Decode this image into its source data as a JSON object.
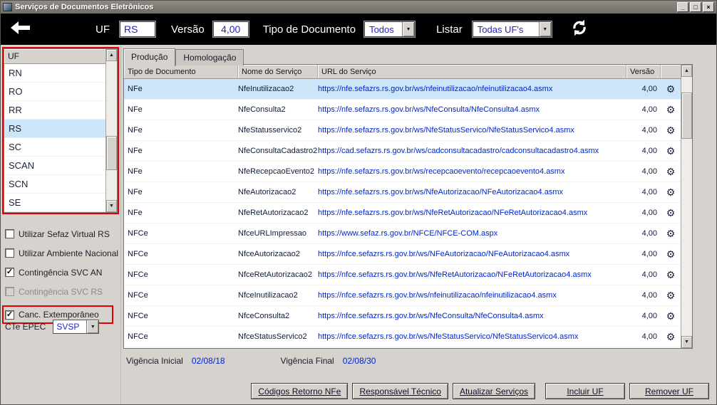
{
  "window": {
    "title": "Serviços de Documentos Eletrônicos",
    "controls": {
      "minimize": "_",
      "maximize": "□",
      "close": "×"
    }
  },
  "toolbar": {
    "uf_label": "UF",
    "uf_value": "RS",
    "versao_label": "Versão",
    "versao_value": "4,00",
    "tipo_documento_label": "Tipo de Documento",
    "tipo_documento_value": "Todos",
    "listar_label": "Listar",
    "listar_value": "Todas UF's"
  },
  "sidebar": {
    "list_header": "UF",
    "uf_items": [
      {
        "label": "RN",
        "selected": false
      },
      {
        "label": "RO",
        "selected": false
      },
      {
        "label": "RR",
        "selected": false
      },
      {
        "label": "RS",
        "selected": true
      },
      {
        "label": "SC",
        "selected": false
      },
      {
        "label": "SCAN",
        "selected": false
      },
      {
        "label": "SCN",
        "selected": false
      },
      {
        "label": "SE",
        "selected": false
      }
    ],
    "checkboxes": [
      {
        "label": "Utilizar Sefaz Virtual RS",
        "checked": false,
        "disabled": false,
        "highlighted": false
      },
      {
        "label": "Utilizar Ambiente Nacional",
        "checked": false,
        "disabled": false,
        "highlighted": false
      },
      {
        "label": "Contingência SVC AN",
        "checked": true,
        "disabled": false,
        "highlighted": false
      },
      {
        "label": "Contingência SVC RS",
        "checked": false,
        "disabled": true,
        "highlighted": false
      },
      {
        "label": "Canc. Extemporâneo",
        "checked": true,
        "disabled": false,
        "highlighted": true
      }
    ],
    "cte_epec_label": "CTe EPEC",
    "cte_epec_value": "SVSP"
  },
  "tabs": [
    {
      "label": "Produção",
      "active": true
    },
    {
      "label": "Homologação",
      "active": false
    }
  ],
  "table": {
    "columns": [
      "Tipo de Documento",
      "Nome do Serviço",
      "URL do Serviço",
      "Versão"
    ],
    "rows": [
      {
        "tipo": "NFe",
        "nome": "NfeInutilizacao2",
        "url": "https://nfe.sefazrs.rs.gov.br/ws/nfeinutilizacao/nfeinutilizacao4.asmx",
        "versao": "4,00",
        "selected": true
      },
      {
        "tipo": "NFe",
        "nome": "NfeConsulta2",
        "url": "https://nfe.sefazrs.rs.gov.br/ws/NfeConsulta/NfeConsulta4.asmx",
        "versao": "4,00",
        "selected": false
      },
      {
        "tipo": "NFe",
        "nome": "NfeStatusservico2",
        "url": "https://nfe.sefazrs.rs.gov.br/ws/NfeStatusServico/NfeStatusServico4.asmx",
        "versao": "4,00",
        "selected": false
      },
      {
        "tipo": "NFe",
        "nome": "NfeConsultaCadastro2",
        "url": "https://cad.sefazrs.rs.gov.br/ws/cadconsultacadastro/cadconsultacadastro4.asmx",
        "versao": "4,00",
        "selected": false
      },
      {
        "tipo": "NFe",
        "nome": "NfeRecepcaoEvento2",
        "url": "https://nfe.sefazrs.rs.gov.br/ws/recepcaoevento/recepcaoevento4.asmx",
        "versao": "4,00",
        "selected": false
      },
      {
        "tipo": "NFe",
        "nome": "NfeAutorizacao2",
        "url": "https://nfe.sefazrs.rs.gov.br/ws/NfeAutorizacao/NFeAutorizacao4.asmx",
        "versao": "4,00",
        "selected": false
      },
      {
        "tipo": "NFe",
        "nome": "NfeRetAutorizacao2",
        "url": "https://nfe.sefazrs.rs.gov.br/ws/NfeRetAutorizacao/NFeRetAutorizacao4.asmx",
        "versao": "4,00",
        "selected": false
      },
      {
        "tipo": "NFCe",
        "nome": "NfceURLImpressao",
        "url": "https://www.sefaz.rs.gov.br/NFCE/NFCE-COM.aspx",
        "versao": "4,00",
        "selected": false
      },
      {
        "tipo": "NFCe",
        "nome": "NfceAutorizacao2",
        "url": "https://nfce.sefazrs.rs.gov.br/ws/NFeAutorizacao/NFeAutorizacao4.asmx",
        "versao": "4,00",
        "selected": false
      },
      {
        "tipo": "NFCe",
        "nome": "NfceRetAutorizacao2",
        "url": "https://nfce.sefazrs.rs.gov.br/ws/NfeRetAutorizacao/NFeRetAutorizacao4.asmx",
        "versao": "4,00",
        "selected": false
      },
      {
        "tipo": "NFCe",
        "nome": "NfceInutilizacao2",
        "url": "https://nfce.sefazrs.rs.gov.br/ws/nfeinutilizacao/nfeinutilizacao4.asmx",
        "versao": "4,00",
        "selected": false
      },
      {
        "tipo": "NFCe",
        "nome": "NfceConsulta2",
        "url": "https://nfce.sefazrs.rs.gov.br/ws/NfeConsulta/NfeConsulta4.asmx",
        "versao": "4,00",
        "selected": false
      },
      {
        "tipo": "NFCe",
        "nome": "NfceStatusServico2",
        "url": "https://nfce.sefazrs.rs.gov.br/ws/NfeStatusServico/NfeStatusServico4.asmx",
        "versao": "4,00",
        "selected": false
      }
    ]
  },
  "vigencia": {
    "inicial_label": "Vigência Inicial",
    "inicial_value": "02/08/18",
    "final_label": "Vigência Final",
    "final_value": "02/08/30"
  },
  "footer_buttons": [
    "Códigos Retorno NFe",
    "Responsável Técnico",
    "Atualizar Serviços",
    "Incluir UF",
    "Remover UF"
  ],
  "icons": {
    "gear": "⚙",
    "check": "✓",
    "dropdown_arrow": "▼",
    "scroll_up": "▲",
    "scroll_down": "▼"
  },
  "colors": {
    "selection_blue": "#cde5f8",
    "annotation_red": "#e30000",
    "link_blue": "#0026cc",
    "toolbar_black": "#000000",
    "window_gray": "#d6d3ce"
  }
}
